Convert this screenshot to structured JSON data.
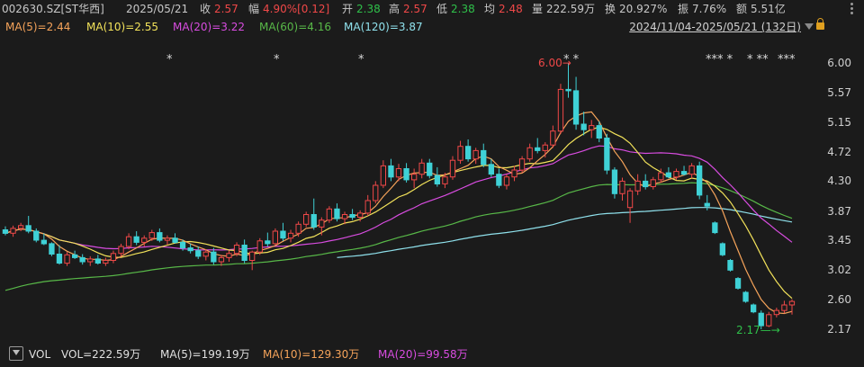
{
  "header": {
    "code": "002630.SZ[ST华西]",
    "date": "2025/05/21",
    "close_label": "收",
    "close_value": "2.57",
    "change_label": "幅",
    "change_value": "4.90%[0.12]",
    "open_label": "开",
    "open_value": "2.38",
    "high_label": "高",
    "high_value": "2.57",
    "low_label": "低",
    "low_value": "2.38",
    "avg_label": "均",
    "avg_value": "2.48",
    "volume_label": "量",
    "volume_value": "222.59万",
    "turnover_label": "换",
    "turnover_value": "20.927%",
    "amplitude_label": "振",
    "amplitude_value": "7.76%",
    "amount_label": "额",
    "amount_value": "5.51亿"
  },
  "ma_legend": {
    "ma5": "MA(5)=2.44",
    "ma10": "MA(10)=2.55",
    "ma20": "MA(20)=3.22",
    "ma60": "MA(60)=4.16",
    "ma120": "MA(120)=3.87"
  },
  "range_selector": "2024/11/04-2025/05/21 (132日)",
  "colors": {
    "up": "#f04848",
    "down": "#3fd1d6",
    "ma5": "#f5a35a",
    "ma10": "#f2e25a",
    "ma20": "#d84ce0",
    "ma60": "#58b848",
    "ma120": "#8fe1ec",
    "background": "#1b1b1b"
  },
  "chart_data": {
    "type": "candlestick",
    "yticks": [
      "6.00",
      "5.57",
      "5.15",
      "4.72",
      "4.30",
      "3.87",
      "3.45",
      "3.02",
      "2.60",
      "2.17"
    ],
    "ylim": [
      2.0,
      6.2
    ],
    "annotations": {
      "high": "6.00",
      "low": "2.17"
    },
    "star_markers": "*",
    "star_groups": [
      "*",
      "*",
      "*",
      "* *",
      "*** *",
      "* **",
      "***"
    ],
    "candles": [
      [
        3.6,
        3.65,
        3.52,
        3.55
      ],
      [
        3.55,
        3.66,
        3.5,
        3.62
      ],
      [
        3.62,
        3.7,
        3.58,
        3.66
      ],
      [
        3.66,
        3.8,
        3.55,
        3.58
      ],
      [
        3.58,
        3.62,
        3.42,
        3.45
      ],
      [
        3.45,
        3.55,
        3.38,
        3.4
      ],
      [
        3.4,
        3.42,
        3.22,
        3.25
      ],
      [
        3.25,
        3.38,
        3.1,
        3.12
      ],
      [
        3.12,
        3.28,
        3.08,
        3.24
      ],
      [
        3.24,
        3.3,
        3.18,
        3.2
      ],
      [
        3.2,
        3.25,
        3.1,
        3.14
      ],
      [
        3.14,
        3.22,
        3.08,
        3.18
      ],
      [
        3.18,
        3.24,
        3.1,
        3.12
      ],
      [
        3.12,
        3.2,
        3.08,
        3.16
      ],
      [
        3.16,
        3.3,
        3.12,
        3.26
      ],
      [
        3.26,
        3.4,
        3.22,
        3.36
      ],
      [
        3.36,
        3.55,
        3.32,
        3.5
      ],
      [
        3.5,
        3.58,
        3.38,
        3.42
      ],
      [
        3.42,
        3.52,
        3.36,
        3.48
      ],
      [
        3.48,
        3.6,
        3.44,
        3.56
      ],
      [
        3.56,
        3.62,
        3.42,
        3.45
      ],
      [
        3.45,
        3.52,
        3.38,
        3.48
      ],
      [
        3.48,
        3.55,
        3.4,
        3.42
      ],
      [
        3.42,
        3.46,
        3.3,
        3.34
      ],
      [
        3.34,
        3.4,
        3.26,
        3.3
      ],
      [
        3.3,
        3.36,
        3.18,
        3.22
      ],
      [
        3.22,
        3.32,
        3.16,
        3.28
      ],
      [
        3.28,
        3.34,
        3.1,
        3.14
      ],
      [
        3.14,
        3.24,
        3.08,
        3.2
      ],
      [
        3.2,
        3.3,
        3.14,
        3.26
      ],
      [
        3.26,
        3.42,
        3.22,
        3.38
      ],
      [
        3.38,
        3.46,
        3.12,
        3.16
      ],
      [
        3.16,
        3.3,
        3.02,
        3.28
      ],
      [
        3.28,
        3.48,
        3.24,
        3.44
      ],
      [
        3.44,
        3.56,
        3.36,
        3.4
      ],
      [
        3.4,
        3.62,
        3.38,
        3.58
      ],
      [
        3.58,
        3.7,
        3.44,
        3.48
      ],
      [
        3.48,
        3.6,
        3.42,
        3.55
      ],
      [
        3.55,
        3.72,
        3.5,
        3.68
      ],
      [
        3.68,
        3.86,
        3.64,
        3.82
      ],
      [
        3.82,
        4.05,
        3.6,
        3.64
      ],
      [
        3.64,
        3.78,
        3.52,
        3.74
      ],
      [
        3.74,
        3.94,
        3.7,
        3.9
      ],
      [
        3.9,
        3.98,
        3.72,
        3.76
      ],
      [
        3.76,
        3.86,
        3.68,
        3.82
      ],
      [
        3.82,
        3.9,
        3.74,
        3.78
      ],
      [
        3.78,
        3.88,
        3.72,
        3.84
      ],
      [
        3.84,
        4.1,
        3.8,
        4.02
      ],
      [
        4.02,
        4.3,
        3.98,
        4.24
      ],
      [
        4.24,
        4.6,
        4.2,
        4.52
      ],
      [
        4.52,
        4.62,
        4.3,
        4.36
      ],
      [
        4.36,
        4.55,
        4.3,
        4.48
      ],
      [
        4.48,
        4.56,
        4.28,
        4.32
      ],
      [
        4.32,
        4.48,
        4.2,
        4.4
      ],
      [
        4.4,
        4.62,
        4.34,
        4.56
      ],
      [
        4.56,
        4.62,
        4.34,
        4.38
      ],
      [
        4.38,
        4.5,
        4.22,
        4.26
      ],
      [
        4.26,
        4.42,
        4.2,
        4.36
      ],
      [
        4.36,
        4.66,
        4.32,
        4.6
      ],
      [
        4.6,
        4.88,
        4.55,
        4.8
      ],
      [
        4.8,
        4.9,
        4.58,
        4.62
      ],
      [
        4.62,
        4.78,
        4.55,
        4.74
      ],
      [
        4.74,
        4.84,
        4.5,
        4.54
      ],
      [
        4.54,
        4.62,
        4.36,
        4.4
      ],
      [
        4.4,
        4.48,
        4.2,
        4.24
      ],
      [
        4.24,
        4.4,
        4.18,
        4.36
      ],
      [
        4.36,
        4.52,
        4.3,
        4.46
      ],
      [
        4.46,
        4.66,
        4.42,
        4.62
      ],
      [
        4.62,
        4.84,
        4.58,
        4.78
      ],
      [
        4.78,
        4.92,
        4.7,
        4.74
      ],
      [
        4.74,
        4.86,
        4.64,
        4.82
      ],
      [
        4.82,
        5.1,
        4.78,
        5.02
      ],
      [
        5.02,
        5.7,
        4.98,
        5.62
      ],
      [
        5.62,
        6.0,
        5.5,
        5.6
      ],
      [
        5.6,
        5.8,
        5.04,
        5.12
      ],
      [
        5.12,
        5.3,
        4.96,
        5.04
      ],
      [
        5.04,
        5.18,
        4.92,
        5.1
      ],
      [
        5.1,
        5.16,
        4.86,
        4.92
      ],
      [
        4.92,
        4.98,
        4.4,
        4.46
      ],
      [
        4.46,
        4.5,
        4.05,
        4.12
      ],
      [
        4.12,
        4.35,
        4.02,
        4.3
      ],
      [
        3.92,
        4.2,
        3.7,
        4.16
      ],
      [
        4.16,
        4.4,
        4.1,
        4.3
      ],
      [
        4.3,
        4.4,
        4.18,
        4.22
      ],
      [
        4.22,
        4.36,
        4.18,
        4.32
      ],
      [
        4.32,
        4.48,
        4.28,
        4.42
      ],
      [
        4.42,
        4.5,
        4.34,
        4.36
      ],
      [
        4.36,
        4.48,
        4.32,
        4.44
      ],
      [
        4.44,
        4.52,
        4.38,
        4.4
      ],
      [
        4.4,
        4.56,
        4.34,
        4.52
      ],
      [
        4.52,
        4.58,
        4.04,
        4.1
      ],
      [
        3.98,
        4.1,
        3.88,
        3.94
      ],
      [
        3.7,
        3.72,
        3.54,
        3.56
      ],
      [
        3.4,
        3.42,
        3.22,
        3.24
      ],
      [
        3.16,
        3.18,
        3.0,
        3.02
      ],
      [
        2.9,
        2.92,
        2.74,
        2.76
      ],
      [
        2.7,
        2.72,
        2.55,
        2.57
      ],
      [
        2.52,
        2.54,
        2.4,
        2.42
      ],
      [
        2.4,
        2.44,
        2.17,
        2.22
      ],
      [
        2.22,
        2.42,
        2.2,
        2.38
      ],
      [
        2.38,
        2.48,
        2.34,
        2.44
      ],
      [
        2.44,
        2.58,
        2.4,
        2.52
      ],
      [
        2.52,
        2.6,
        2.38,
        2.57
      ]
    ]
  },
  "volume_legend": {
    "label": "VOL",
    "vol": "VOL=222.59万",
    "ma5": "MA(5)=199.19万",
    "ma10": "MA(10)=129.30万",
    "ma20": "MA(20)=99.58万"
  }
}
